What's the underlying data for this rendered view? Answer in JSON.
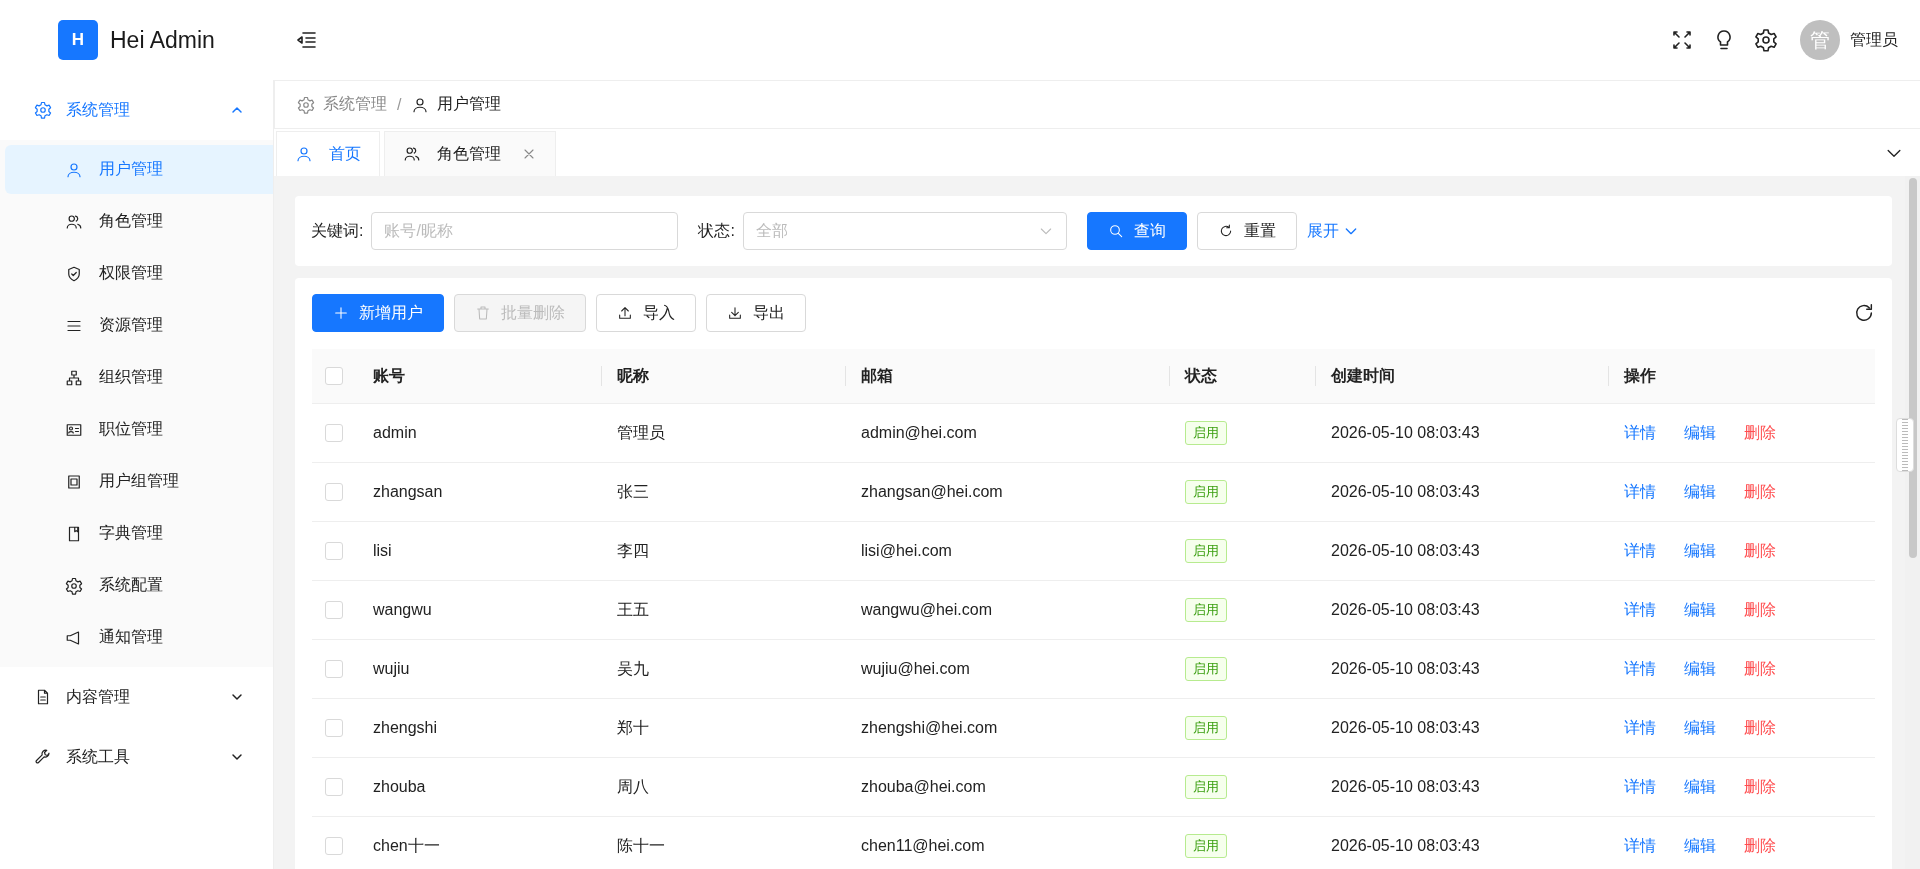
{
  "header": {
    "logo_letter": "H",
    "app_name": "Hei Admin",
    "avatar_text": "管",
    "user_name": "管理员"
  },
  "sidebar": {
    "items": [
      {
        "label": "系统管理",
        "expanded": true,
        "selected": false,
        "children": [
          {
            "label": "用户管理",
            "selected": true
          },
          {
            "label": "角色管理",
            "selected": false
          },
          {
            "label": "权限管理",
            "selected": false
          },
          {
            "label": "资源管理",
            "selected": false
          },
          {
            "label": "组织管理",
            "selected": false
          },
          {
            "label": "职位管理",
            "selected": false
          },
          {
            "label": "用户组管理",
            "selected": false
          },
          {
            "label": "字典管理",
            "selected": false
          },
          {
            "label": "系统配置",
            "selected": false
          },
          {
            "label": "通知管理",
            "selected": false
          }
        ]
      },
      {
        "label": "内容管理",
        "expanded": false,
        "selected": false
      },
      {
        "label": "系统工具",
        "expanded": false,
        "selected": false
      }
    ]
  },
  "breadcrumb": [
    "系统管理",
    "/",
    "用户管理"
  ],
  "tabs": [
    {
      "label": "首页",
      "selected": true,
      "closable": false
    },
    {
      "label": "角色管理",
      "selected": false,
      "closable": true
    }
  ],
  "search": {
    "keyword_label": "关键词:",
    "keyword_placeholder": "账号/昵称",
    "status_label": "状态:",
    "status_placeholder": "全部",
    "query_button": "查询",
    "reset_button": "重置",
    "expand_link": "展开"
  },
  "toolbar": [
    {
      "label": "新增用户",
      "kind": "primary",
      "disabled": false
    },
    {
      "label": "批量删除",
      "kind": "delete",
      "disabled": true
    },
    {
      "label": "导入",
      "kind": "import",
      "disabled": false
    },
    {
      "label": "导出",
      "kind": "export",
      "disabled": false
    }
  ],
  "table": {
    "select_all_checked": false,
    "columns": [
      "账号",
      "昵称",
      "邮箱",
      "状态",
      "创建时间",
      "操作"
    ],
    "rows": [
      {
        "account": "admin",
        "nickname": "管理员",
        "email": "admin@hei.com",
        "status": "启用",
        "created": "2026-05-10 08:03:43",
        "checked": false,
        "actions": [
          {
            "label": "详情",
            "kind": "link"
          },
          {
            "label": "编辑",
            "kind": "link"
          },
          {
            "label": "删除",
            "kind": "danger"
          }
        ]
      },
      {
        "account": "zhangsan",
        "nickname": "张三",
        "email": "zhangsan@hei.com",
        "status": "启用",
        "created": "2026-05-10 08:03:43",
        "checked": false,
        "actions": [
          {
            "label": "详情",
            "kind": "link"
          },
          {
            "label": "编辑",
            "kind": "link"
          },
          {
            "label": "删除",
            "kind": "danger"
          }
        ]
      },
      {
        "account": "lisi",
        "nickname": "李四",
        "email": "lisi@hei.com",
        "status": "启用",
        "created": "2026-05-10 08:03:43",
        "checked": false,
        "actions": [
          {
            "label": "详情",
            "kind": "link"
          },
          {
            "label": "编辑",
            "kind": "link"
          },
          {
            "label": "删除",
            "kind": "danger"
          }
        ]
      },
      {
        "account": "wangwu",
        "nickname": "王五",
        "email": "wangwu@hei.com",
        "status": "启用",
        "created": "2026-05-10 08:03:43",
        "checked": false,
        "actions": [
          {
            "label": "详情",
            "kind": "link"
          },
          {
            "label": "编辑",
            "kind": "link"
          },
          {
            "label": "删除",
            "kind": "danger"
          }
        ]
      },
      {
        "account": "wujiu",
        "nickname": "吴九",
        "email": "wujiu@hei.com",
        "status": "启用",
        "created": "2026-05-10 08:03:43",
        "checked": false,
        "actions": [
          {
            "label": "详情",
            "kind": "link"
          },
          {
            "label": "编辑",
            "kind": "link"
          },
          {
            "label": "删除",
            "kind": "danger"
          }
        ]
      },
      {
        "account": "zhengshi",
        "nickname": "郑十",
        "email": "zhengshi@hei.com",
        "status": "启用",
        "created": "2026-05-10 08:03:43",
        "checked": false,
        "actions": [
          {
            "label": "详情",
            "kind": "link"
          },
          {
            "label": "编辑",
            "kind": "link"
          },
          {
            "label": "删除",
            "kind": "danger"
          }
        ]
      },
      {
        "account": "zhouba",
        "nickname": "周八",
        "email": "zhouba@hei.com",
        "status": "启用",
        "created": "2026-05-10 08:03:43",
        "checked": false,
        "actions": [
          {
            "label": "详情",
            "kind": "link"
          },
          {
            "label": "编辑",
            "kind": "link"
          },
          {
            "label": "删除",
            "kind": "danger"
          }
        ]
      },
      {
        "account": "chen十一",
        "nickname": "陈十一",
        "email": "chen11@hei.com",
        "status": "启用",
        "created": "2026-05-10 08:03:43",
        "checked": false,
        "actions": [
          {
            "label": "详情",
            "kind": "link"
          },
          {
            "label": "编辑",
            "kind": "link"
          },
          {
            "label": "删除",
            "kind": "danger"
          }
        ]
      }
    ]
  }
}
